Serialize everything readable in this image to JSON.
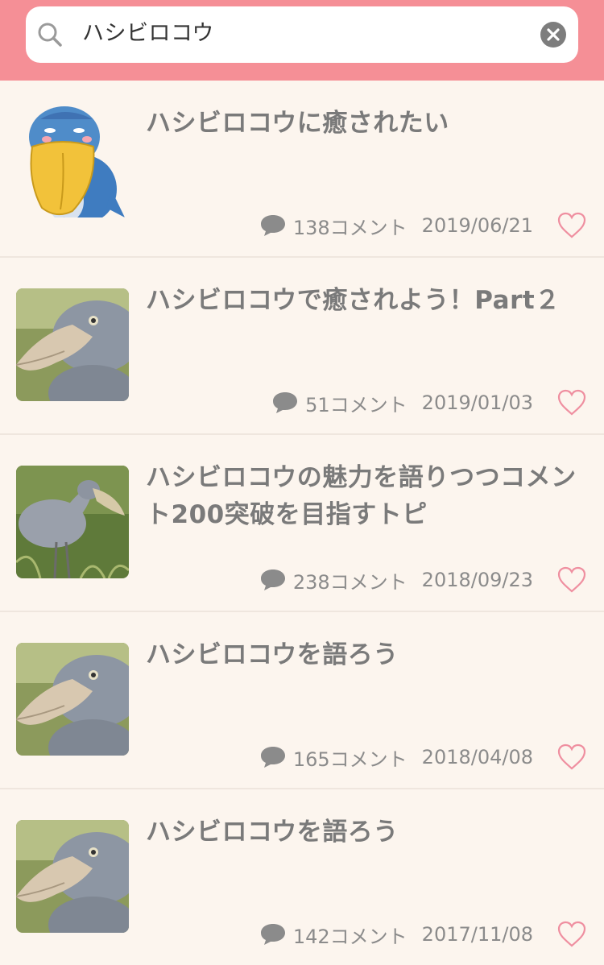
{
  "search": {
    "query": "ハシビロコウ",
    "icon": "search-icon",
    "clear_icon": "clear-icon"
  },
  "colors": {
    "header": "#f58f96",
    "background": "#fcf5ee",
    "title": "#7a7a7a",
    "meta": "#8b8b8b",
    "heart": "#ef8fa0"
  },
  "topics": [
    {
      "title": "ハシビロコウに癒されたい",
      "comments": "138コメント",
      "date": "2019/06/21",
      "thumb": "illustration"
    },
    {
      "title": "ハシビロコウで癒されよう！Part２",
      "comments": "51コメント",
      "date": "2019/01/03",
      "thumb": "photo"
    },
    {
      "title": "ハシビロコウの魅力を語りつつコメント200突破を目指すトピ",
      "comments": "238コメント",
      "date": "2018/09/23",
      "thumb": "photo-standing"
    },
    {
      "title": "ハシビロコウを語ろう",
      "comments": "165コメント",
      "date": "2018/04/08",
      "thumb": "photo"
    },
    {
      "title": "ハシビロコウを語ろう",
      "comments": "142コメント",
      "date": "2017/11/08",
      "thumb": "photo"
    }
  ]
}
